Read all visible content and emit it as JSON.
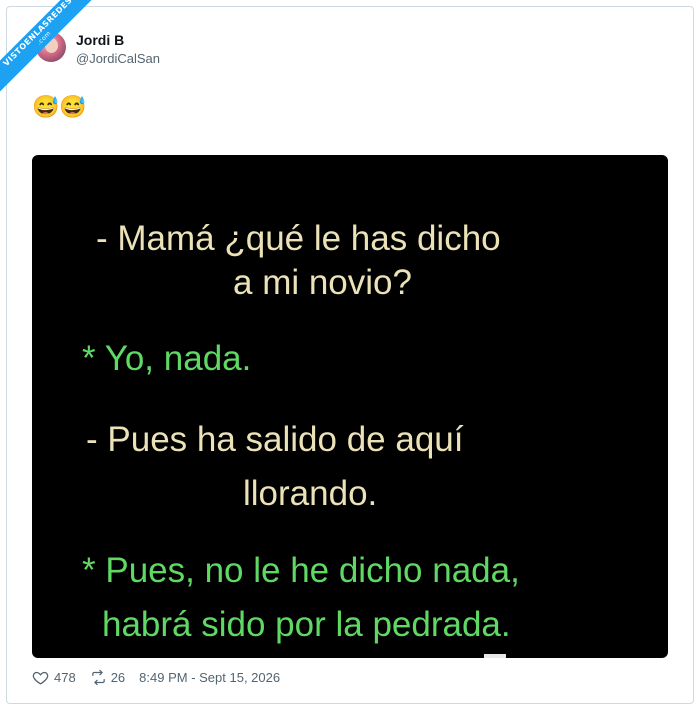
{
  "watermark": {
    "text": "VISTOENLASREDES",
    "sub": ".com"
  },
  "user": {
    "name": "Jordi B",
    "handle": "@JordiCalSan"
  },
  "tweet": {
    "text": "😅😅"
  },
  "image_text": {
    "lines": [
      {
        "text": "- Mamá ¿qué le has dicho",
        "color": "#ece2b8"
      },
      {
        "text": "a mi novio?",
        "color": "#ece2b8"
      },
      {
        "text": "* Yo, nada.",
        "color": "#5fd964"
      },
      {
        "text": "- Pues ha salido de aquí",
        "color": "#ece2b8"
      },
      {
        "text": "llorando.",
        "color": "#ece2b8"
      },
      {
        "text": "* Pues, no le he dicho nada,",
        "color": "#5fd964"
      },
      {
        "text": "habrá sido por la pedrada.",
        "color": "#5fd964"
      }
    ]
  },
  "stats": {
    "likes": "478",
    "retweets": "26",
    "timestamp": "8:49 PM - Sept 15, 2026"
  },
  "icons": {
    "like": "heart-icon",
    "retweet": "retweet-icon"
  },
  "colors": {
    "ribbon": "#1da1f2",
    "image_bg": "#000000",
    "muted": "#536471"
  }
}
